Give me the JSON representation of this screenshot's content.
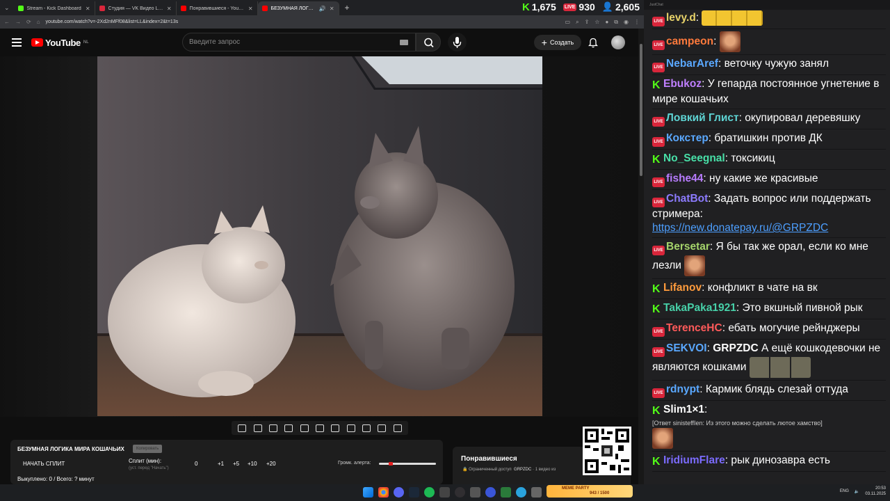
{
  "browser": {
    "tabs": [
      {
        "title": "Stream - Kick Dashboard",
        "favicon_color": "#53fc18",
        "active": false
      },
      {
        "title": "Студия — VK Видео Live",
        "favicon_color": "#d9263b",
        "active": false
      },
      {
        "title": "Понравившиеся - YouTube",
        "favicon_color": "#ff0000",
        "active": false
      },
      {
        "title": "БЕЗУМНАЯ ЛОГИКА МИ...",
        "favicon_color": "#ff0000",
        "active": true
      }
    ],
    "new_tab": "+",
    "url": "youtube.com/watch?v=-2Xd2nMFf08&list=LL&index=2&t=13s"
  },
  "viewer_stats": {
    "kick": "1,675",
    "vk": "930",
    "vk_badge": "LIVE",
    "total": "2,605"
  },
  "youtube": {
    "logo": "YouTube",
    "region": "NL",
    "search_placeholder": "Введите запрос",
    "create_label": "Создать",
    "create_icon": "+"
  },
  "video_panel": {
    "title": "БЕЗУМНАЯ ЛОГИКА МИРА КОШАЧЬИХ",
    "badge": "Копировать",
    "start_split": "НАЧАТЬ СПЛИТ",
    "split_label": "Сплит (мин):",
    "split_hint": "(уст. перед \"Начать\")",
    "split_value": "0",
    "increments": [
      "+1",
      "+5",
      "+10",
      "+20"
    ],
    "volume_label": "Громк. алерта:",
    "volume_level": 0.18,
    "bought": "Выкуплено: 0 / Всего: ? минут"
  },
  "playlist": {
    "title": "Понравившиеся",
    "access": "Ограниченный доступ",
    "owner": "GRPZDC",
    "count": "· 1 видео из"
  },
  "meme_party": {
    "label": "MEME PARTY",
    "progress": "943 / 1500"
  },
  "taskbar": {
    "lang": "ENG",
    "time": "20:53",
    "date": "03.11.2025"
  },
  "chat": {
    "window_title": "JustChat",
    "messages": [
      {
        "platform": "vk",
        "user": "levy.d",
        "color": "#e8d36a",
        "text": "",
        "emote": "yellow-faces"
      },
      {
        "platform": "vk",
        "user": "campeon",
        "color": "#ff7a3c",
        "text": "",
        "emote": "face"
      },
      {
        "platform": "vk",
        "user": "NebarAref",
        "color": "#5aa8ff",
        "text": "веточку чужую занял"
      },
      {
        "platform": "kick",
        "user": "Ebukoz",
        "color": "#bf7fff",
        "text": "У гепарда постоянное угнетение в мире кошачьих"
      },
      {
        "platform": "vk",
        "user": "Ловкий Глист",
        "color": "#5ed4d4",
        "text": "окупировал деревяшку"
      },
      {
        "platform": "vk",
        "user": "Кокстер",
        "color": "#5aa8ff",
        "text": "братишкин против ДК"
      },
      {
        "platform": "kick",
        "user": "No_Seegnal",
        "color": "#48e0a8",
        "text": "токсикиц"
      },
      {
        "platform": "vk",
        "user": "fishe44",
        "color": "#b87cff",
        "text": "ну какие же красивые"
      },
      {
        "platform": "vk",
        "user": "ChatBot",
        "color": "#8c7bff",
        "text": "Задать вопрос или поддержать стримера:",
        "link": "https://new.donatepay.ru/@GRPZDC"
      },
      {
        "platform": "vk",
        "user": "Bersetar",
        "color": "#a5d46b",
        "text": "Я бы так же орал, если ко мне лезли",
        "emote": "face"
      },
      {
        "platform": "kick",
        "user": "Lifanov",
        "color": "#ff9b3c",
        "text": "конфликт в чате на вк"
      },
      {
        "platform": "kick",
        "user": "TakaPaka1921",
        "color": "#47d0a8",
        "text": "Это вкшный пивной рык"
      },
      {
        "platform": "vk",
        "user": "TerenceHC",
        "color": "#ff5a5a",
        "text": "ебать могучие рейнджеры"
      },
      {
        "platform": "vk",
        "user": "SEKVOI",
        "color": "#5aa8ff",
        "mention": "GRPZDC",
        "text": "А ещё кошкодевочки не являются кошками",
        "emote": "triple"
      },
      {
        "platform": "vk",
        "user": "rdnypt",
        "color": "#5aa8ff",
        "text": "Кармик блядь слезай оттуда"
      },
      {
        "platform": "kick",
        "user": "Slim1×1",
        "color": "#ffffff",
        "reply": "[Ответ sinisteffIen: Из этого можно сделать лютое хамство]",
        "text": "",
        "emote": "face"
      },
      {
        "platform": "kick",
        "user": "IridiumFlare",
        "color": "#7b6bff",
        "text": "рык динозавра есть"
      }
    ]
  }
}
